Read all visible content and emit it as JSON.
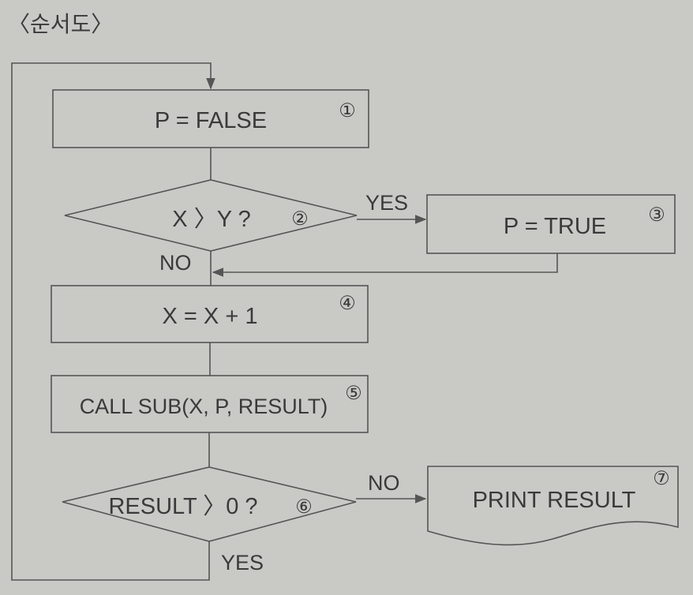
{
  "title": "〈순서도〉",
  "nodes": {
    "n1": {
      "label": "P = FALSE",
      "num": "①"
    },
    "n2": {
      "label": "X 〉Y ?",
      "num": "②"
    },
    "n3": {
      "label": "P = TRUE",
      "num": "③"
    },
    "n4": {
      "label": "X = X + 1",
      "num": "④"
    },
    "n5": {
      "label": "CALL SUB(X, P, RESULT)",
      "num": "⑤"
    },
    "n6": {
      "label": "RESULT 〉0 ?",
      "num": "⑥"
    },
    "n7": {
      "label": "PRINT RESULT",
      "num": "⑦"
    }
  },
  "edges": {
    "d2_yes": "YES",
    "d2_no": "NO",
    "d6_no": "NO",
    "d6_yes": "YES"
  }
}
